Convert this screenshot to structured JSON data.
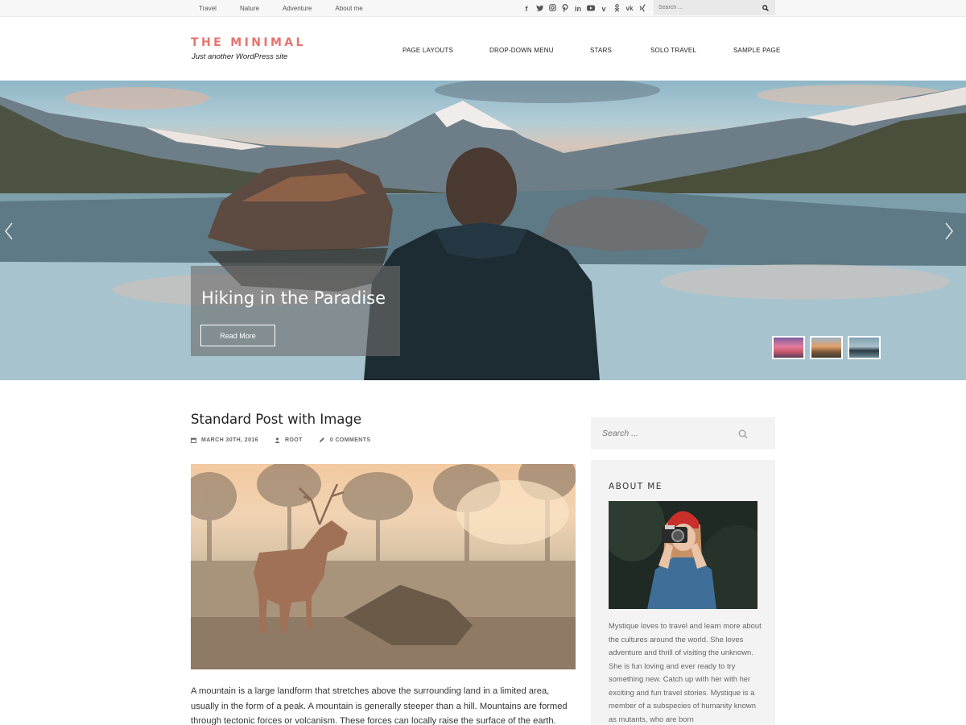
{
  "topbar": {
    "nav": [
      "Travel",
      "Nature",
      "Adventure",
      "About me"
    ],
    "social_icons": [
      "facebook-icon",
      "twitter-icon",
      "instagram-icon",
      "pinterest-icon",
      "linkedin-icon",
      "youtube-icon",
      "vimeo-icon",
      "odnoklassniki-icon",
      "vk-icon",
      "xing-icon"
    ],
    "search_placeholder": "Search ..."
  },
  "header": {
    "site_title": "THE MINIMAL",
    "tagline": "Just another WordPress site",
    "nav": [
      "PAGE LAYOUTS",
      "DROP-DOWN MENU",
      "STARS",
      "SOLO TRAVEL",
      "SAMPLE PAGE"
    ]
  },
  "hero": {
    "caption_title": "Hiking in the Paradise",
    "button_label": "Read More",
    "thumbnail_count": 3
  },
  "post": {
    "title": "Standard Post with Image",
    "date": "MARCH 30TH, 2016",
    "author": "ROOT",
    "comments": "0 COMMENTS",
    "body": "A mountain is a large landform that stretches above the surrounding land in a limited area, usually in the form of a peak. A mountain is generally steeper than a hill. Mountains are formed through tectonic forces or volcanism. These forces can locally raise the surface of the earth. Mountains erode"
  },
  "sidebar": {
    "search_placeholder": "Search ...",
    "about_title": "ABOUT ME",
    "about_text": "Mystique loves to travel and learn more about the cultures around the world. She loves adventure and thrill of visiting the unknown. She is fun loving and ever ready to try something new. Catch up with her with her exciting and fun travel stories. Mystique is a member of a subspecies of humanity known as mutants, who are born"
  },
  "colors": {
    "accent": "#e8726e",
    "topbar_bg": "#f7f7f7",
    "sidebar_bg": "#f3f3f3"
  }
}
